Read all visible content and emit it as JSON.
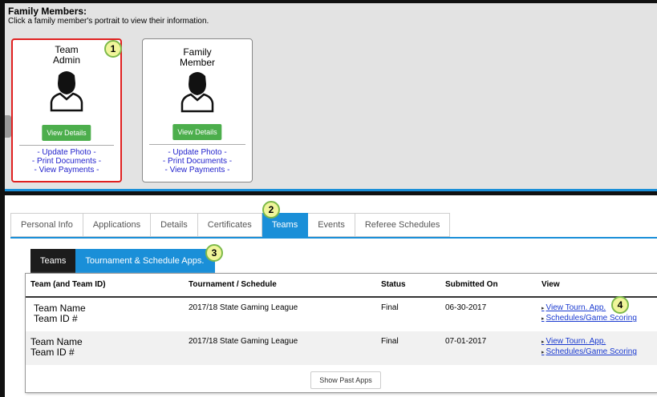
{
  "family": {
    "title": "Family Members:",
    "subtitle": "Click a family member's portrait to view their information.",
    "cards": [
      {
        "role_line1": "Team",
        "role_line2": "Admin",
        "button": "View Details",
        "links": [
          "- Update Photo -",
          "- Print Documents -",
          "- View Payments -"
        ],
        "selected": true
      },
      {
        "role_line1": "Family",
        "role_line2": "Member",
        "button": "View Details",
        "links": [
          "- Update Photo -",
          "- Print Documents -",
          "- View Payments -"
        ],
        "selected": false
      }
    ]
  },
  "badges": [
    "1",
    "2",
    "3",
    "4"
  ],
  "tabs": [
    "Personal Info",
    "Applications",
    "Details",
    "Certificates",
    "Teams",
    "Events",
    "Referee Schedules"
  ],
  "active_tab": "Teams",
  "subtabs": [
    "Teams",
    "Tournament & Schedule Apps."
  ],
  "active_subtab": "Tournament & Schedule Apps.",
  "table": {
    "headers": [
      "Team (and Team ID)",
      "Tournament / Schedule",
      "Status",
      "Submitted On",
      "View"
    ],
    "rows": [
      {
        "team": "Team Name",
        "team_id": "Team ID #",
        "tournament": "2017/18 State Gaming League",
        "status": "Final",
        "submitted": "06-30-2017",
        "link1": "View Tourn. App.",
        "link2": "Schedules/Game Scoring"
      },
      {
        "team": "Team Name",
        "team_id": "Team ID #",
        "tournament": "2017/18 State Gaming League",
        "status": "Final",
        "submitted": "07-01-2017",
        "link1": "View Tourn. App.",
        "link2": "Schedules/Game Scoring"
      }
    ],
    "show_past": "Show Past Apps"
  },
  "colors": {
    "accent": "#1a8fd8",
    "button_green": "#4cae4c",
    "selected_border": "#e02020",
    "badge_fill": "#f0f59a",
    "link": "#1a3ad0"
  }
}
